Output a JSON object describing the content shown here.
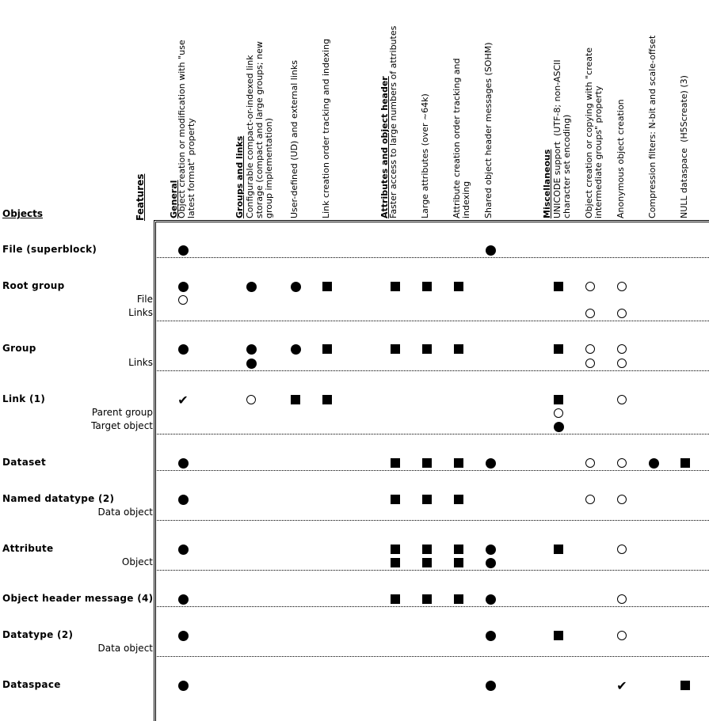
{
  "header": {
    "objects_title": "Objects",
    "features_title": "Features",
    "columns": [
      {
        "kind": "group",
        "label": "General"
      },
      {
        "kind": "feature",
        "label": "Object creation or modification with \"use\nlatest format\" property"
      },
      {
        "kind": "group",
        "label": "Groups and links"
      },
      {
        "kind": "feature",
        "label": "Configurable compact-or-indexed link\nstorage (compact and large groups; new\ngroup implementation)"
      },
      {
        "kind": "feature",
        "label": "User-defined (UD) and external links"
      },
      {
        "kind": "feature",
        "label": "Link creation order tracking and indexing"
      },
      {
        "kind": "group",
        "label": "Attributes and object header"
      },
      {
        "kind": "feature",
        "label": "Faster access to large numbers of attributes"
      },
      {
        "kind": "feature",
        "label": "Large attributes (over ~64k)"
      },
      {
        "kind": "feature",
        "label": "Attribute creation order tracking and\nindexing"
      },
      {
        "kind": "feature",
        "label": "Shared object header messages (SOHM)"
      },
      {
        "kind": "group",
        "label": "Miscellaneous"
      },
      {
        "kind": "feature",
        "label": "UNICODE support  (UTF-8; non-ASCII\ncharacter set encoding)"
      },
      {
        "kind": "feature",
        "label": "Object creation or copying with \"create\nintermediate groups\" property"
      },
      {
        "kind": "feature",
        "label": "Anonymous object creation"
      },
      {
        "kind": "feature",
        "label": "Compression filters: N-bit and scale-offset"
      },
      {
        "kind": "feature",
        "label": "NULL dataspace  (H5Screate) (3)"
      }
    ]
  },
  "legend_symbols": {
    "filled-circle": "●",
    "open-circle": "○",
    "filled-square": "■",
    "check": "✔"
  },
  "rows": [
    {
      "object": "File (superblock)",
      "lines": [
        {
          "sub": "",
          "marks": {
            "1": "filled-circle",
            "8": "filled-circle"
          }
        }
      ]
    },
    {
      "object": "Root group",
      "lines": [
        {
          "sub": "",
          "marks": {
            "1": "filled-circle",
            "2": "filled-circle",
            "3": "filled-circle",
            "4": "filled-square",
            "5": "filled-square",
            "6": "filled-square",
            "7": "filled-square",
            "9": "filled-square",
            "10": "open-circle",
            "11": "open-circle"
          }
        },
        {
          "sub": "File",
          "marks": {
            "1": "open-circle"
          }
        },
        {
          "sub": "Links",
          "marks": {
            "10": "open-circle",
            "11": "open-circle"
          }
        }
      ]
    },
    {
      "object": "Group",
      "lines": [
        {
          "sub": "",
          "marks": {
            "1": "filled-circle",
            "2": "filled-circle",
            "3": "filled-circle",
            "4": "filled-square",
            "5": "filled-square",
            "6": "filled-square",
            "7": "filled-square",
            "9": "filled-square",
            "10": "open-circle",
            "11": "open-circle"
          }
        },
        {
          "sub": "Links",
          "marks": {
            "2": "filled-circle",
            "10": "open-circle",
            "11": "open-circle"
          }
        }
      ]
    },
    {
      "object": "Link (1)",
      "lines": [
        {
          "sub": "",
          "marks": {
            "1": "check",
            "2": "open-circle",
            "3": "filled-square",
            "4": "filled-square",
            "9": "filled-square",
            "11": "open-circle"
          }
        },
        {
          "sub": "Parent group",
          "marks": {
            "9": "open-circle"
          }
        },
        {
          "sub": "Target object",
          "marks": {
            "9": "filled-circle"
          }
        }
      ]
    },
    {
      "object": "Dataset",
      "lines": [
        {
          "sub": "",
          "marks": {
            "1": "filled-circle",
            "5": "filled-square",
            "6": "filled-square",
            "7": "filled-square",
            "8": "filled-circle",
            "10": "open-circle",
            "11": "open-circle",
            "12": "filled-circle",
            "13": "filled-square"
          }
        }
      ]
    },
    {
      "object": "Named datatype (2)",
      "lines": [
        {
          "sub": "",
          "marks": {
            "1": "filled-circle",
            "5": "filled-square",
            "6": "filled-square",
            "7": "filled-square",
            "10": "open-circle",
            "11": "open-circle"
          }
        },
        {
          "sub": "Data object",
          "marks": {}
        }
      ]
    },
    {
      "object": "Attribute",
      "lines": [
        {
          "sub": "",
          "marks": {
            "1": "filled-circle",
            "5": "filled-square",
            "6": "filled-square",
            "7": "filled-square",
            "8": "filled-circle",
            "9": "filled-square",
            "11": "open-circle"
          }
        },
        {
          "sub": "Object",
          "marks": {
            "5": "filled-square",
            "6": "filled-square",
            "7": "filled-square",
            "8": "filled-circle"
          }
        }
      ]
    },
    {
      "object": "Object header message (4)",
      "lines": [
        {
          "sub": "",
          "marks": {
            "1": "filled-circle",
            "5": "filled-square",
            "6": "filled-square",
            "7": "filled-square",
            "8": "filled-circle",
            "11": "open-circle"
          }
        }
      ]
    },
    {
      "object": "Datatype (2)",
      "lines": [
        {
          "sub": "",
          "marks": {
            "1": "filled-circle",
            "8": "filled-circle",
            "9": "filled-square",
            "11": "open-circle"
          }
        },
        {
          "sub": "Data object",
          "marks": {}
        }
      ]
    },
    {
      "object": "Dataspace",
      "lines": [
        {
          "sub": "",
          "marks": {
            "1": "filled-circle",
            "8": "filled-circle",
            "11": "check",
            "13": "filled-square"
          }
        }
      ]
    }
  ]
}
